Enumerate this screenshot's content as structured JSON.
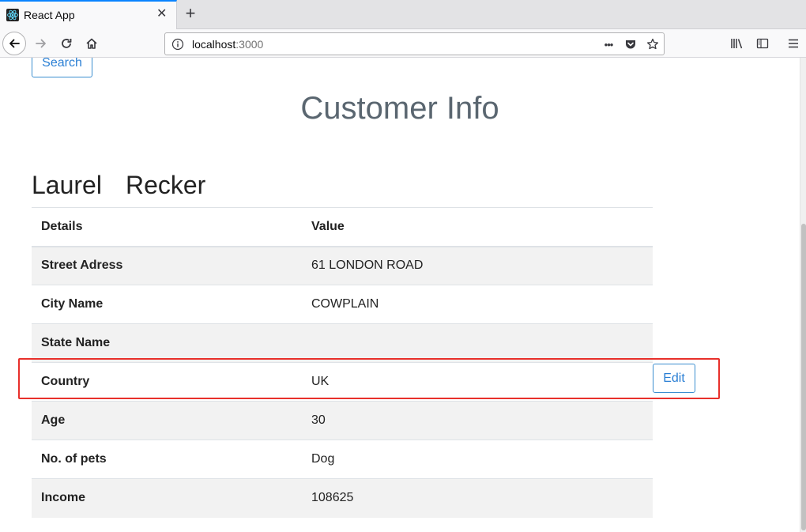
{
  "browser": {
    "tab_title": "React App",
    "tab_close": "✕",
    "new_tab": "+",
    "url_host": "localhost",
    "url_port": ":3000",
    "url_more": "•••"
  },
  "page": {
    "search_label": "Search",
    "title": "Customer Info",
    "first_name": "Laurel",
    "last_name": "Recker",
    "edit_label": "Edit"
  },
  "table": {
    "headers": [
      "Details",
      "Value"
    ],
    "rows": [
      {
        "label": "Street Adress",
        "value": "61 LONDON ROAD"
      },
      {
        "label": "City Name",
        "value": "COWPLAIN"
      },
      {
        "label": "State Name",
        "value": ""
      },
      {
        "label": "Country",
        "value": "UK"
      },
      {
        "label": "Age",
        "value": "30"
      },
      {
        "label": "No. of pets",
        "value": "Dog"
      },
      {
        "label": "Income",
        "value": "108625"
      }
    ]
  },
  "colors": {
    "accent": "#2a7fd4",
    "highlight": "#e8302b",
    "tab_accent": "#0a84ff"
  }
}
